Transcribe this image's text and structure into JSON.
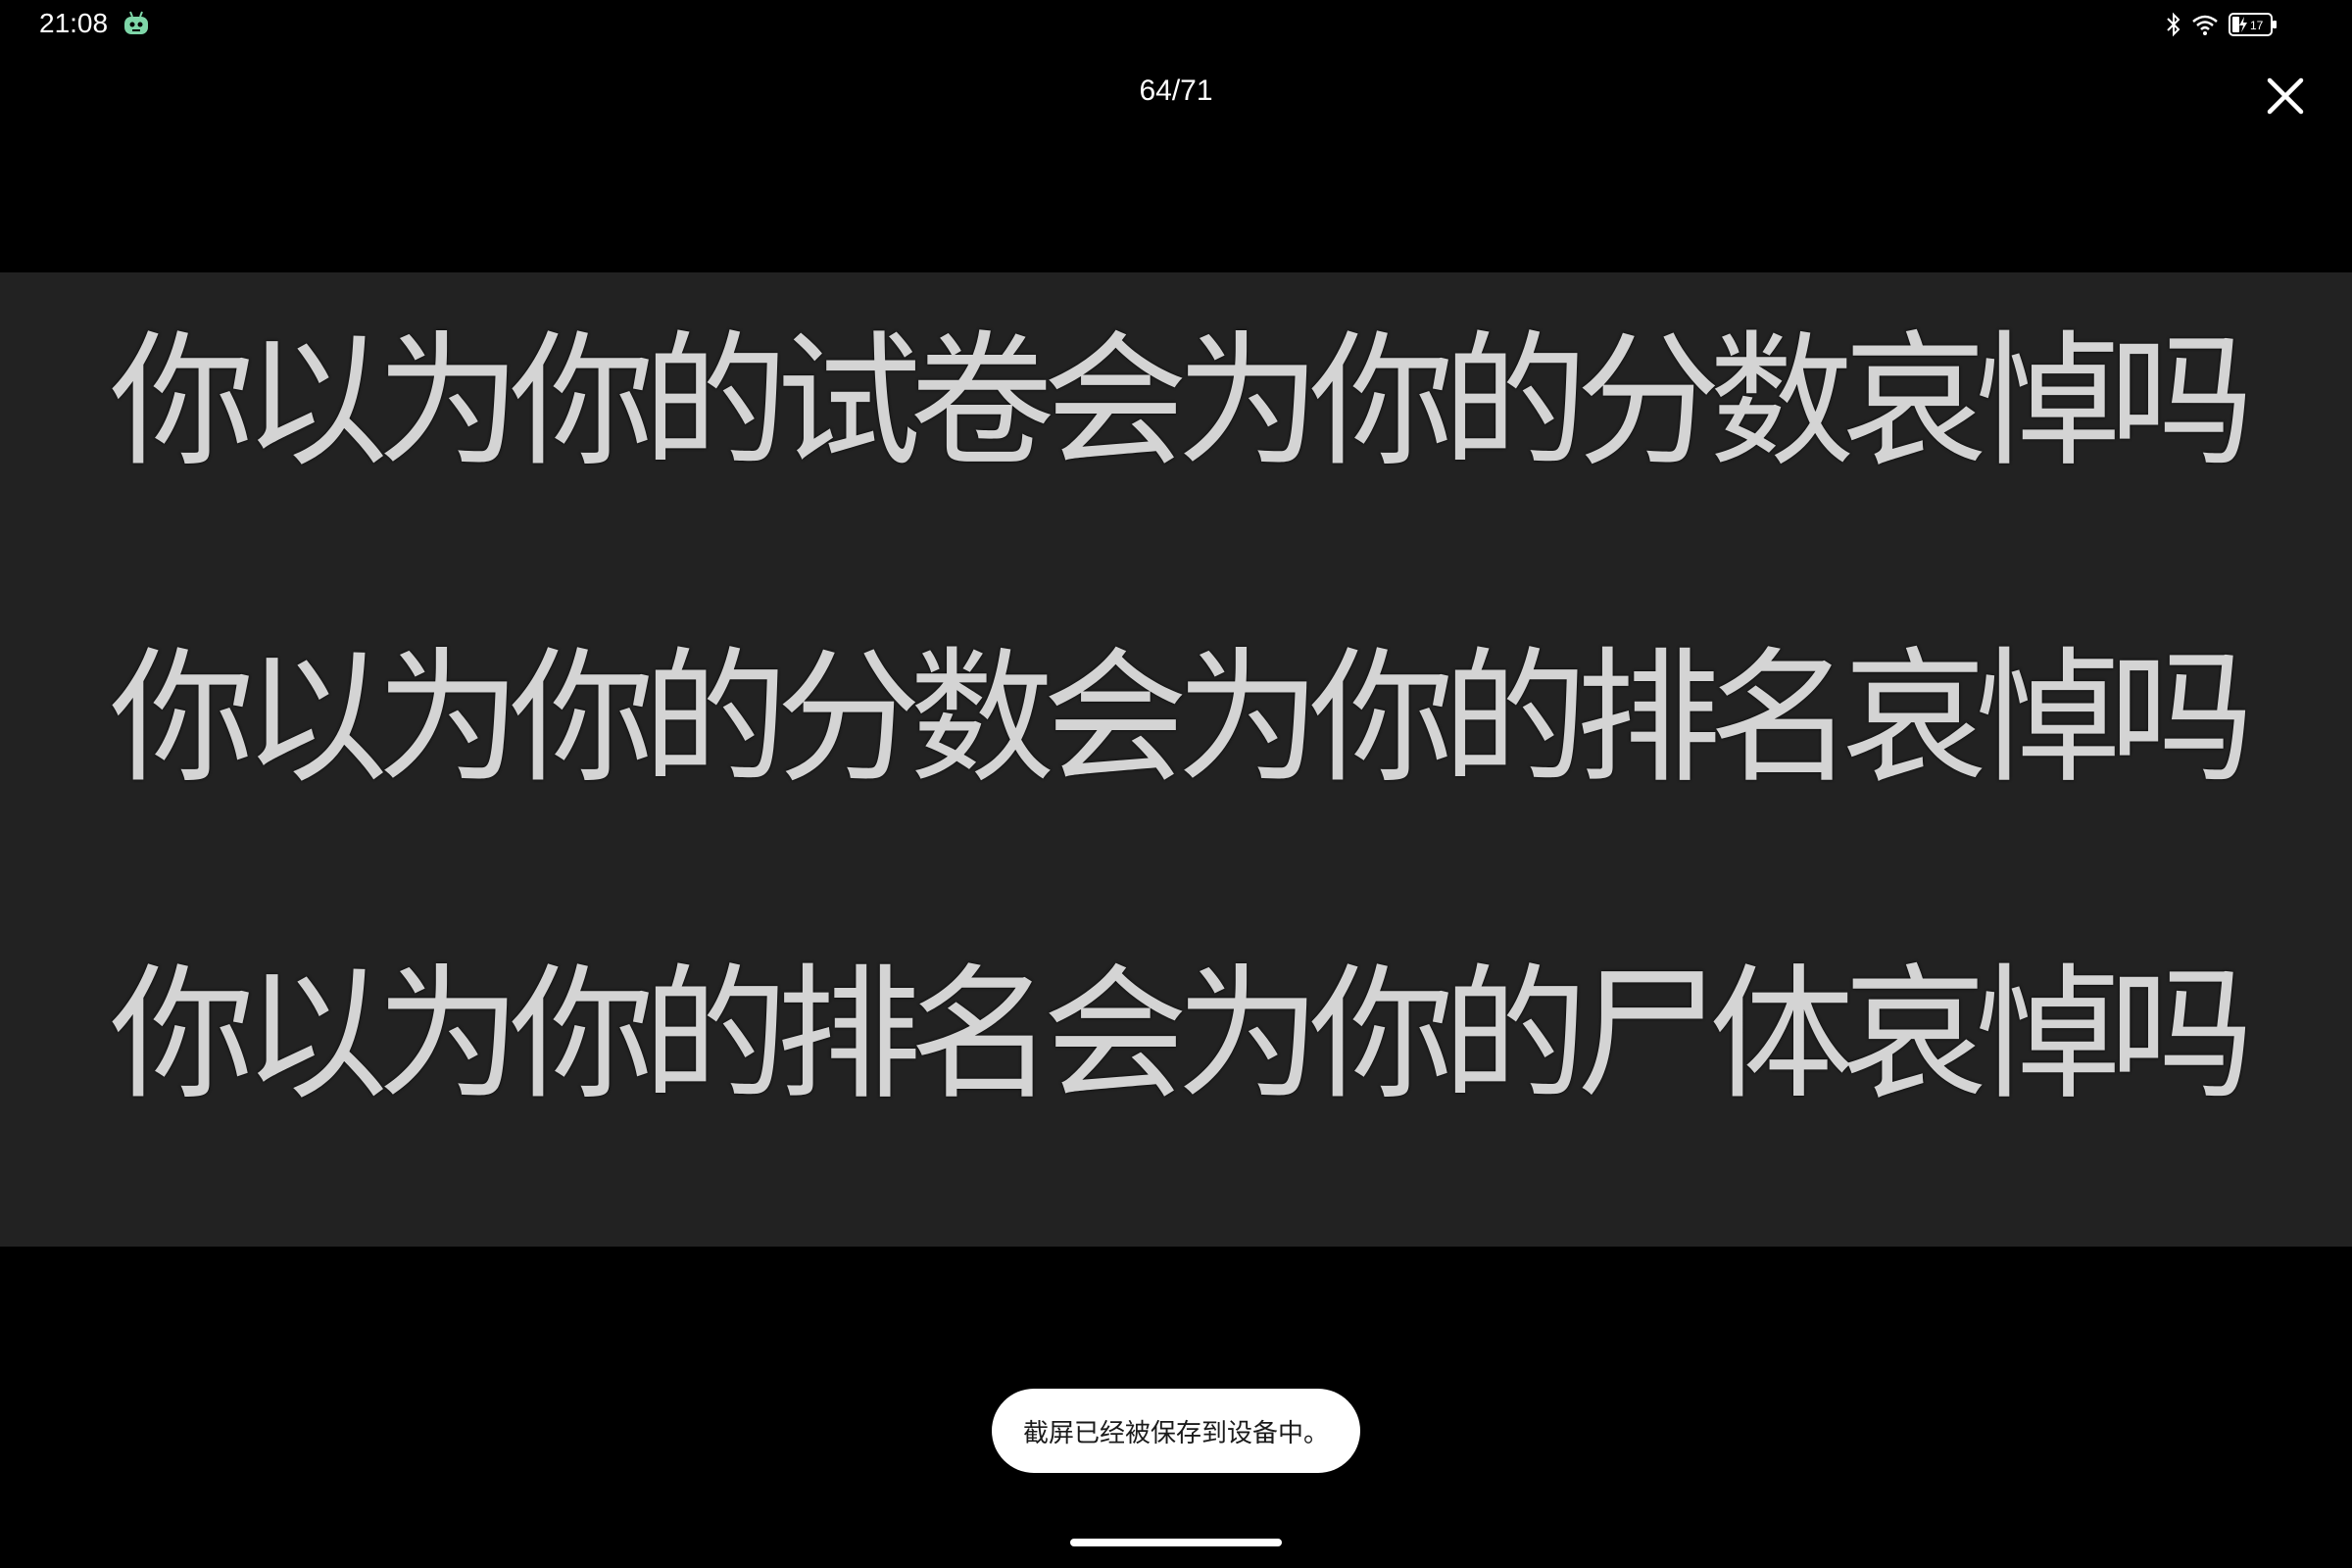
{
  "status_bar": {
    "time": "21:08",
    "battery_level": "17",
    "icons": [
      "robot-icon",
      "bluetooth-icon",
      "wifi-icon",
      "battery-charging-icon"
    ]
  },
  "viewer": {
    "counter": "64/71",
    "close_icon": "close-icon"
  },
  "image": {
    "lines": [
      "你以为你的试卷会为你的分数哀悼吗",
      "你以为你的分数会为你的排名哀悼吗",
      "你以为你的排名会为你的尸体哀悼吗"
    ]
  },
  "toast": {
    "message": "截屏已经被保存到设备中。"
  },
  "colors": {
    "background": "#000000",
    "image_background": "#222222",
    "image_text": "#d4d4d4",
    "toast_background": "#ffffff",
    "robot_icon": "#7ed6a8"
  }
}
